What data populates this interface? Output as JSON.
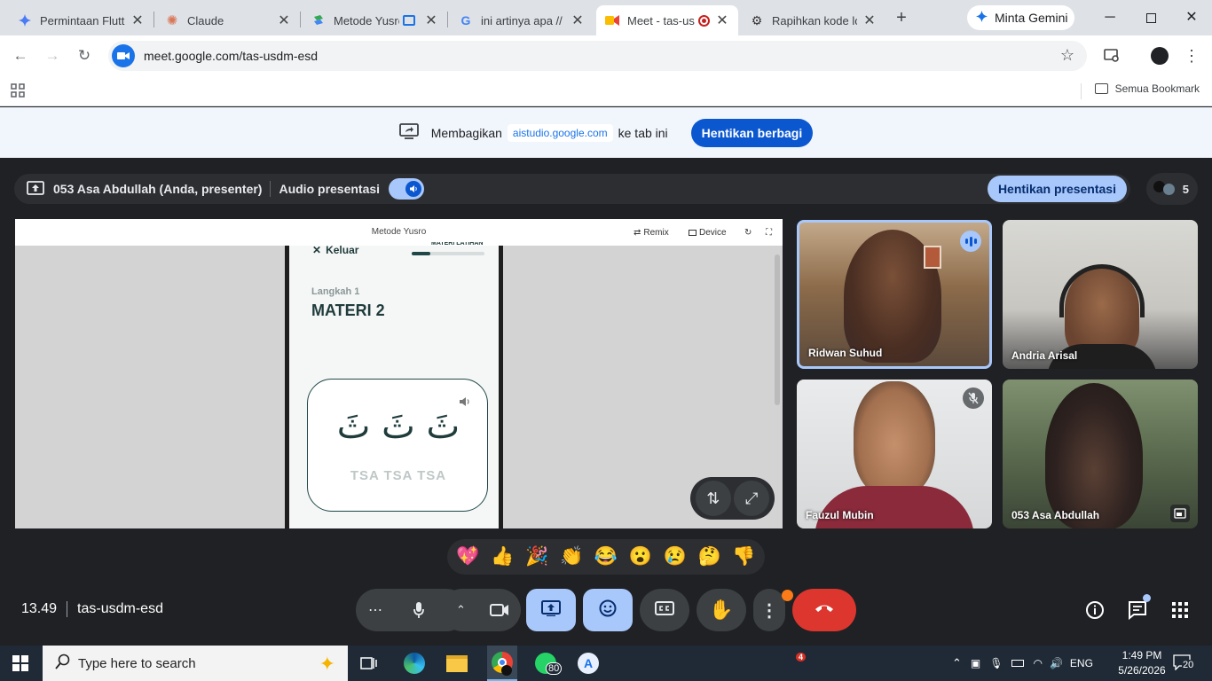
{
  "browser": {
    "tabs": [
      {
        "title": "Permintaan Flutte",
        "icon": "gemini-icon"
      },
      {
        "title": "Claude",
        "icon": "claude-icon"
      },
      {
        "title": "Metode Yusro",
        "icon": "ai-studio-icon"
      },
      {
        "title": "ini artinya apa // f",
        "icon": "google-icon"
      },
      {
        "title": "Meet - tas-usd",
        "icon": "meet-icon"
      },
      {
        "title": "Rapihkan kode lo",
        "icon": "chatgpt-icon"
      }
    ],
    "gemini_label": "Minta Gemini",
    "url": "meet.google.com/tas-usdm-esd",
    "bookmarks_label": "Semua Bookmark"
  },
  "share_banner": {
    "text_before": "Membagikan",
    "site": "aistudio.google.com",
    "text_after": "ke tab ini",
    "stop_label": "Hentikan berbagi"
  },
  "presenter_bar": {
    "presenter": "053 Asa Abdullah (Anda, presenter)",
    "audio_label": "Audio presentasi",
    "stop_label": "Hentikan presentasi",
    "people_count": "5"
  },
  "presentation": {
    "window_title": "Metode Yusro",
    "remix_label": "Remix",
    "device_label": "Device",
    "exit_label": "Keluar",
    "progress_label": "MATERI LATIHAN",
    "progress": 0.25,
    "step_label": "Langkah 1",
    "title": "MATERI 2",
    "arabic": "ثَ ثَ ثَ",
    "latin": "TSA TSA TSA"
  },
  "participants": [
    {
      "name": "Ridwan Suhud",
      "status": "speaking"
    },
    {
      "name": "Andria Arisal",
      "status": ""
    },
    {
      "name": "Fauzul Mubin",
      "status": "muted"
    },
    {
      "name": "053 Asa Abdullah",
      "status": "self"
    }
  ],
  "reactions": [
    "💖",
    "👍",
    "🎉",
    "👏",
    "😂",
    "😮",
    "😢",
    "🤔",
    "👎"
  ],
  "meeting": {
    "time": "13.49",
    "code": "tas-usdm-esd"
  },
  "taskbar": {
    "search_placeholder": "Type here to search",
    "whatsapp_badge": "80",
    "notify_badge": "4",
    "lang": "ENG",
    "time": "1:49 PM",
    "date": "5/26/2026",
    "notifications": "20"
  }
}
